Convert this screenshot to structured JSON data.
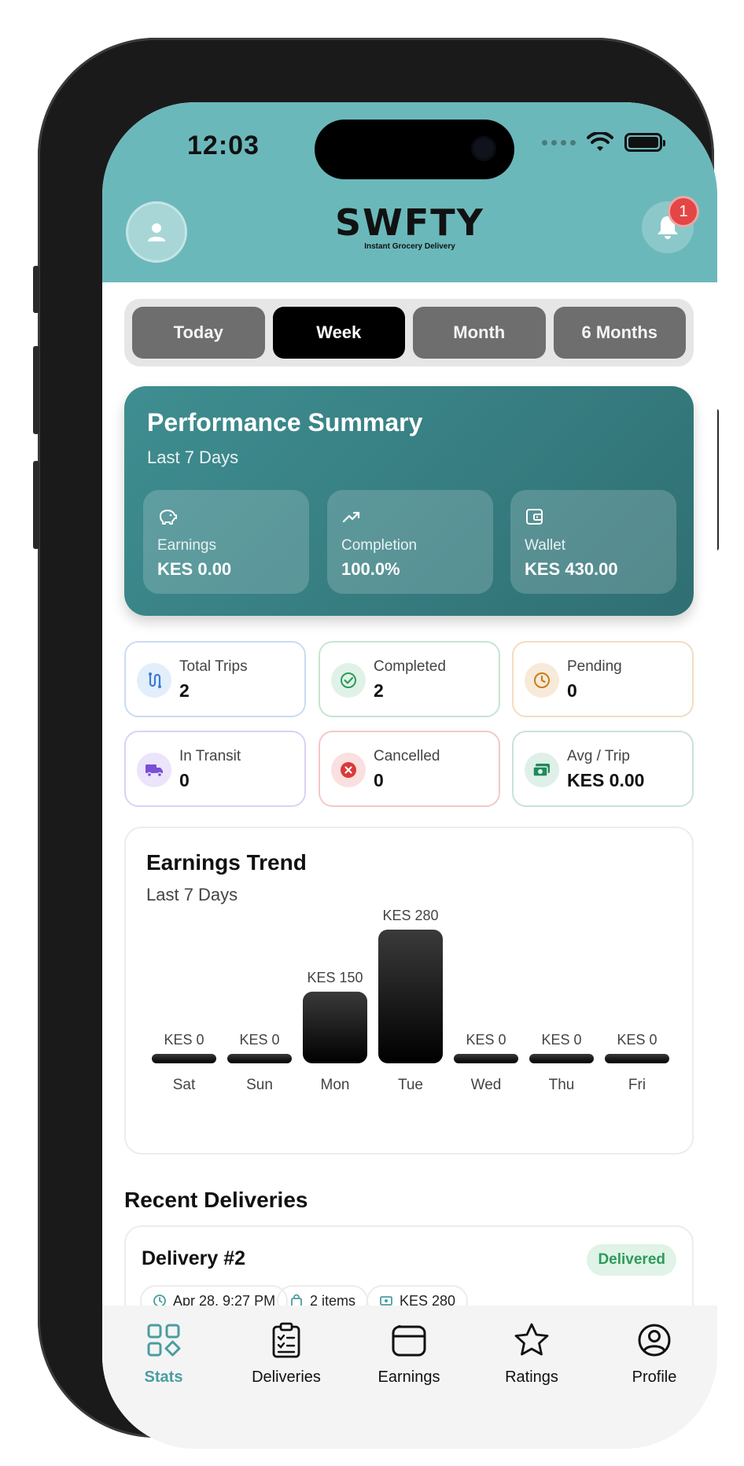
{
  "status_bar": {
    "time": "12:03"
  },
  "header": {
    "logo_main": "SWFTY",
    "logo_sub": "Instant Grocery Delivery",
    "notification_count": "1"
  },
  "period_tabs": [
    {
      "label": "Today",
      "active": false
    },
    {
      "label": "Week",
      "active": true
    },
    {
      "label": "Month",
      "active": false
    },
    {
      "label": "6 Months",
      "active": false
    }
  ],
  "summary": {
    "title": "Performance Summary",
    "subtitle": "Last 7 Days",
    "metrics": [
      {
        "label": "Earnings",
        "value": "KES 0.00",
        "icon": "piggy-bank-icon"
      },
      {
        "label": "Completion",
        "value": "100.0%",
        "icon": "trending-up-icon"
      },
      {
        "label": "Wallet",
        "value": "KES 430.00",
        "icon": "wallet-icon"
      }
    ]
  },
  "stats": [
    {
      "label": "Total Trips",
      "value": "2",
      "icon": "route-icon",
      "color": "#3a7bd5"
    },
    {
      "label": "Completed",
      "value": "2",
      "icon": "check-circle-icon",
      "color": "#2e9a5a"
    },
    {
      "label": "Pending",
      "value": "0",
      "icon": "clock-icon",
      "color": "#c87d1e"
    },
    {
      "label": "In Transit",
      "value": "0",
      "icon": "truck-icon",
      "color": "#7b4fd6"
    },
    {
      "label": "Cancelled",
      "value": "0",
      "icon": "x-circle-icon",
      "color": "#d93a3a"
    },
    {
      "label": "Avg / Trip",
      "value": "KES 0.00",
      "icon": "cash-icon",
      "color": "#1f8a5a"
    }
  ],
  "chart_data": {
    "type": "bar",
    "title": "Earnings Trend",
    "subtitle": "Last 7 Days",
    "categories": [
      "Sat",
      "Sun",
      "Mon",
      "Tue",
      "Wed",
      "Thu",
      "Fri"
    ],
    "values": [
      0,
      0,
      150,
      280,
      0,
      0,
      0
    ],
    "value_labels": [
      "KES 0",
      "KES 0",
      "KES 150",
      "KES 280",
      "KES 0",
      "KES 0",
      "KES 0"
    ],
    "ylim": [
      0,
      280
    ],
    "grid": false,
    "legend": "none"
  },
  "recent": {
    "title": "Recent Deliveries",
    "delivery": {
      "title": "Delivery #2",
      "status": "Delivered",
      "date": "Apr 28, 9:27 PM",
      "items": "2 items",
      "amount": "KES 280"
    }
  },
  "nav": [
    {
      "label": "Stats",
      "icon": "grid-icon",
      "active": true
    },
    {
      "label": "Deliveries",
      "icon": "clipboard-list-icon",
      "active": false
    },
    {
      "label": "Earnings",
      "icon": "wallet-icon",
      "active": false
    },
    {
      "label": "Ratings",
      "icon": "star-icon",
      "active": false
    },
    {
      "label": "Profile",
      "icon": "user-circle-icon",
      "active": false
    }
  ],
  "colors": {
    "header": "#6bb8bb",
    "accent": "#4a9da0",
    "summary": "#2f6f73"
  }
}
